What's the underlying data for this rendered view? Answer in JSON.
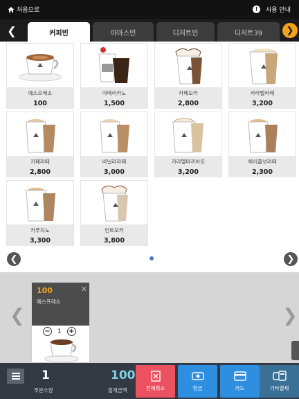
{
  "topbar": {
    "home_label": "처음으로",
    "help_label": "사용 안내",
    "info_glyph": "!"
  },
  "tabs": [
    {
      "label": "커피빈",
      "active": true
    },
    {
      "label": "아마스빈",
      "active": false
    },
    {
      "label": "디저트빈",
      "active": false
    },
    {
      "label": "디저트39",
      "active": false
    }
  ],
  "products": [
    {
      "name": "에스프레소",
      "price": "100",
      "icon": "espresso-cup-icon"
    },
    {
      "name": "아메리카노",
      "price": "1,500",
      "icon": "americano-cup-icon"
    },
    {
      "name": "카페모카",
      "price": "2,800",
      "icon": "mocha-cup-icon"
    },
    {
      "name": "카라멜라떼",
      "price": "3,200",
      "icon": "caramel-latte-cup-icon"
    },
    {
      "name": "카페라떼",
      "price": "2,800",
      "icon": "latte-cup-icon"
    },
    {
      "name": "바닐라라떼",
      "price": "3,000",
      "icon": "vanilla-latte-cup-icon"
    },
    {
      "name": "카라멜마끼아또",
      "price": "3,200",
      "icon": "caramel-macchiato-cup-icon"
    },
    {
      "name": "헤이즐넛라떼",
      "price": "2,300",
      "icon": "hazelnut-latte-cup-icon"
    },
    {
      "name": "카푸치노",
      "price": "3,300",
      "icon": "cappuccino-cup-icon"
    },
    {
      "name": "민트모카",
      "price": "3,800",
      "icon": "mint-mocha-cup-icon"
    }
  ],
  "order_item": {
    "price": "100",
    "name": "에스프레소",
    "quantity": "1"
  },
  "summary": {
    "order_count": "1",
    "order_count_label": "주문수량",
    "total": "100",
    "total_label": "합계금액"
  },
  "actions": [
    {
      "label": "전체취소",
      "color": "#ec5160",
      "icon": "cancel-all-icon"
    },
    {
      "label": "현금",
      "color": "#2e8fe0",
      "icon": "cash-icon"
    },
    {
      "label": "카드",
      "color": "#2e8fe0",
      "icon": "card-icon"
    },
    {
      "label": "기타결제",
      "color": "#3a6f96",
      "icon": "other-payment-icon"
    }
  ],
  "colors": {
    "accent": "#f0a41c",
    "cancel": "#ec5160",
    "pay": "#2e8fe0",
    "dark_bar": "#121212",
    "bottom_bar": "#333942"
  }
}
